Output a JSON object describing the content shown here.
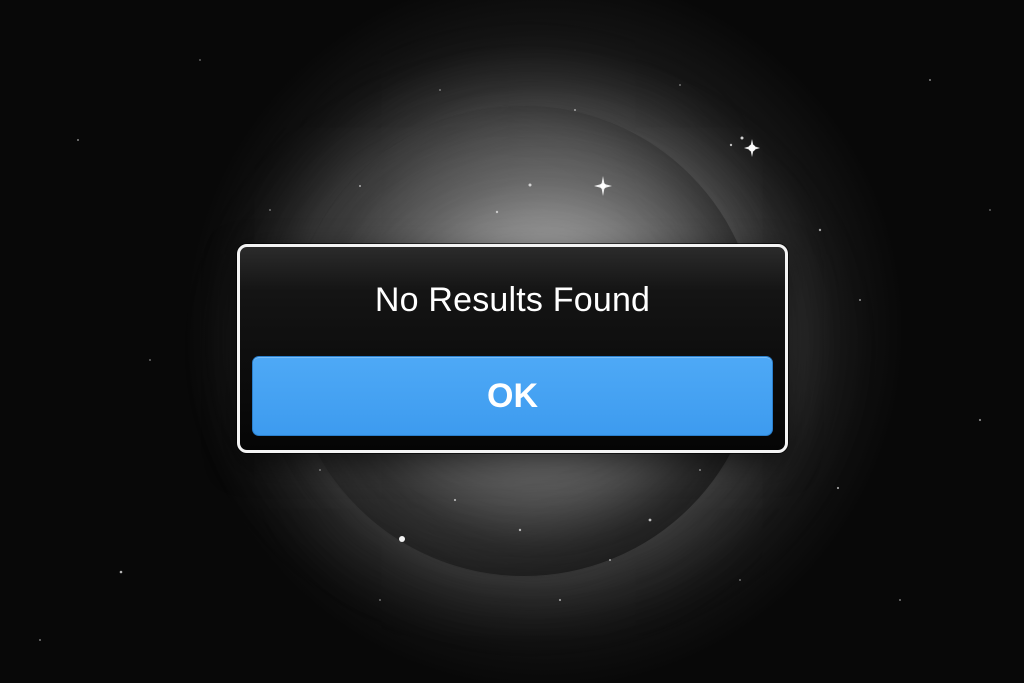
{
  "background": {
    "description_icon": "space-planet-background"
  },
  "alert": {
    "title": "No Results Found",
    "ok_label": "OK",
    "accent_color": "#3f9cf0",
    "border_color": "#f4f4f4"
  }
}
